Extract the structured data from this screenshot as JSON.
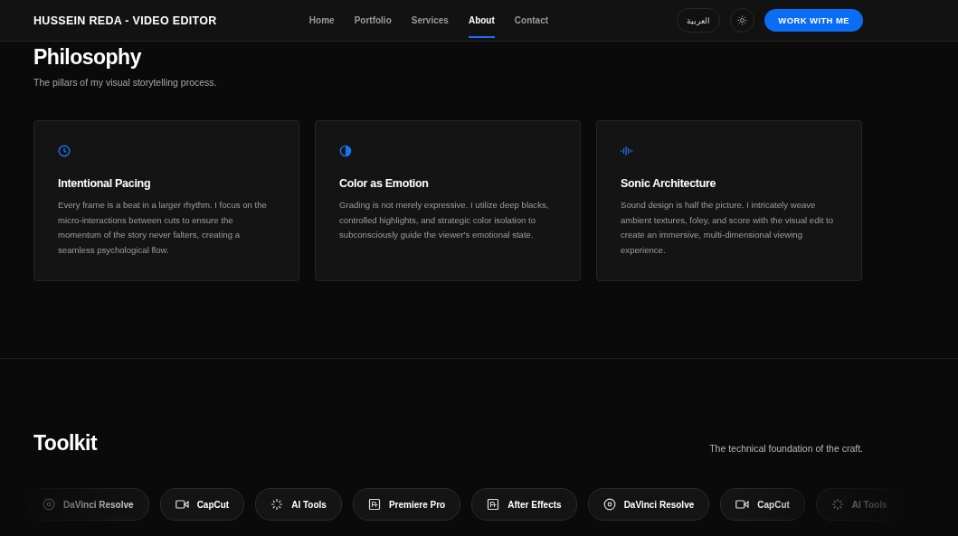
{
  "header": {
    "brand": "HUSSEIN REDA - VIDEO EDITOR",
    "nav": [
      {
        "label": "Home",
        "selected": false
      },
      {
        "label": "Portfolio",
        "selected": false
      },
      {
        "label": "Services",
        "selected": false
      },
      {
        "label": "About",
        "selected": true
      },
      {
        "label": "Contact",
        "selected": false
      }
    ],
    "language_button": "العربية",
    "cta": "WORK WITH ME"
  },
  "philosophy": {
    "title": "Philosophy",
    "subtitle": "The pillars of my visual storytelling process.",
    "cards": [
      {
        "kind": "clock",
        "title": "Intentional Pacing",
        "text": "Every frame is a beat in a larger rhythm. I focus on the micro-interactions between cuts to ensure the momentum of the story never falters, creating a seamless psychological flow."
      },
      {
        "kind": "contrast",
        "title": "Color as Emotion",
        "text": "Grading is not merely expressive. I utilize deep blacks, controlled highlights, and strategic color isolation to subconsciously guide the viewer's emotional state."
      },
      {
        "kind": "wave",
        "title": "Sonic Architecture",
        "text": "Sound design is half the picture. I intricately weave ambient textures, foley, and score with the visual edit to create an immersive, multi-dimensional viewing experience."
      }
    ]
  },
  "toolkit": {
    "title": "Toolkit",
    "tagline": "The technical foundation of the craft.",
    "tools": [
      {
        "kind": "resolve",
        "label": "DaVinci Resolve"
      },
      {
        "kind": "capcut",
        "label": "CapCut"
      },
      {
        "kind": "ai",
        "label": "AI Tools"
      },
      {
        "kind": "premiere",
        "label": "Premiere Pro"
      },
      {
        "kind": "aftereffects",
        "label": "After Effects"
      },
      {
        "kind": "resolve",
        "label": "DaVinci Resolve"
      },
      {
        "kind": "capcut",
        "label": "CapCut"
      },
      {
        "kind": "ai",
        "label": "AI Tools"
      }
    ]
  }
}
